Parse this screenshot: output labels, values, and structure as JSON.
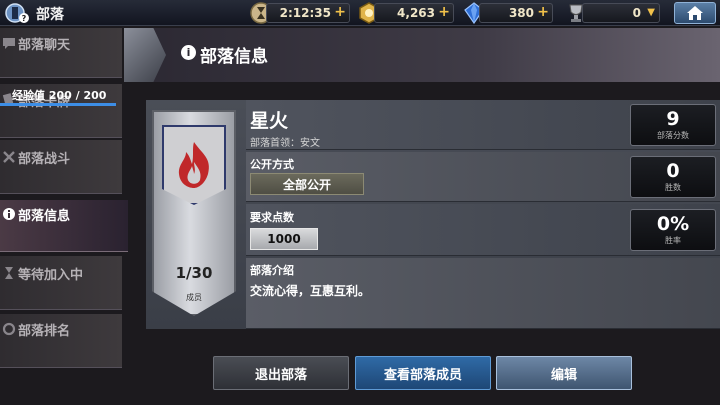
{
  "header": {
    "title": "部落",
    "resources": [
      {
        "name": "timer",
        "value": "2:12:35",
        "action": "+"
      },
      {
        "name": "gold",
        "value": "4,263",
        "action": "+"
      },
      {
        "name": "gems",
        "value": "380",
        "action": "+"
      },
      {
        "name": "trophy",
        "value": "0",
        "action": "▼"
      }
    ],
    "badge_count": "2"
  },
  "sidebar": {
    "items": [
      {
        "label": "部落聊天",
        "icon": "chat-icon"
      },
      {
        "label": "部落卡牌",
        "icon": "cards-icon"
      },
      {
        "label": "部落战斗",
        "icon": "swords-icon"
      },
      {
        "label": "部落信息",
        "icon": "info-icon"
      },
      {
        "label": "等待加入中",
        "icon": "queue-icon"
      },
      {
        "label": "部落排名",
        "icon": "ranking-icon"
      }
    ],
    "exp_label": "经验值 200 / 200",
    "exp_progress": 1.0
  },
  "panel": {
    "title": "部落信息",
    "clan_name": "星火",
    "leader_label": "部落首领：安文",
    "join_mode_label": "公开方式",
    "join_mode_value": "全部公开",
    "points_label": "要求点数",
    "points_value": "1000",
    "desc_label": "部落介绍",
    "desc_value": "交流心得，互惠互利。",
    "members": "1/30",
    "members_caption": "成员",
    "stats": [
      {
        "value": "9",
        "caption": "部落分数"
      },
      {
        "value": "0",
        "caption": "胜数"
      },
      {
        "value": "0%",
        "caption": "胜率"
      }
    ]
  },
  "buttons": {
    "leave": "退出部落",
    "view_members": "查看部落成员",
    "edit": "编辑"
  },
  "colors": {
    "accent_blue": "#2f6aa6",
    "emblem_red": "#c0282a",
    "gold": "#f2c24a"
  }
}
